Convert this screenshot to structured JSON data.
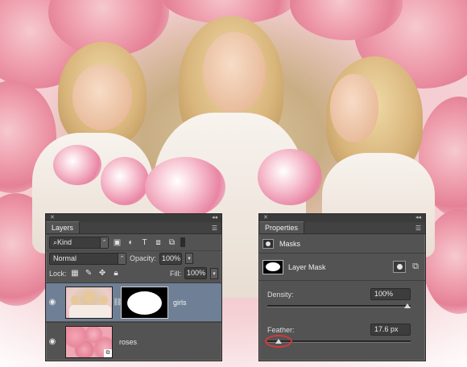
{
  "layers_panel": {
    "tab_label": "Layers",
    "filter_kind": "Kind",
    "blend_mode": "Normal",
    "opacity_label": "Opacity:",
    "opacity_value": "100%",
    "lock_label": "Lock:",
    "fill_label": "Fill:",
    "fill_value": "100%",
    "layers": [
      {
        "name": "girls",
        "selected": true,
        "has_mask": true
      },
      {
        "name": "roses",
        "selected": false,
        "has_mask": false
      }
    ]
  },
  "properties_panel": {
    "tab_label": "Properties",
    "section_title": "Masks",
    "mask_type": "Layer Mask",
    "density_label": "Density:",
    "density_value": "100%",
    "density_level": 1.0,
    "feather_label": "Feather:",
    "feather_value": "17.6 px",
    "feather_level": 0.176
  },
  "colors": {
    "panel_bg": "#535353",
    "selected_layer": "#6f7f95",
    "highlight_circle": "#d8383a"
  },
  "icons": [
    "eye-icon",
    "chain-link-icon",
    "collapse-icon",
    "panel-menu-icon",
    "close-icon",
    "mask-icon",
    "pixel-mask-icon",
    "vector-mask-icon",
    "lock-pixels-icon",
    "lock-paint-icon",
    "lock-move-icon",
    "lock-all-icon",
    "search-icon"
  ]
}
